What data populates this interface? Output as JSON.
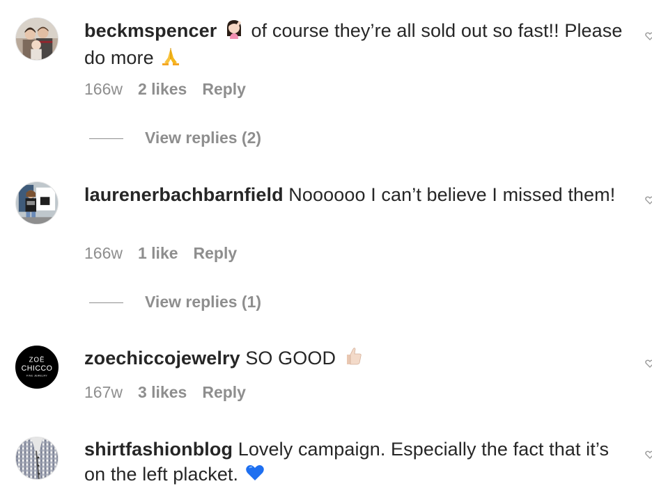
{
  "comments": [
    {
      "username": "beckmspencer",
      "text_before": "of course they’re all sold out so fast!! Please do more",
      "time": "166w",
      "likes": "2 likes",
      "reply": "Reply",
      "view_replies": "View replies (2)",
      "emoji_1": "woman-facepalming-icon",
      "emoji_2": "folded-hands-icon"
    },
    {
      "username": "laurenerbachbarnfield",
      "text": "Noooooo I can’t believe I missed them!",
      "time": "166w",
      "likes": "1 like",
      "reply": "Reply",
      "view_replies": "View replies (1)"
    },
    {
      "username": "zoechiccojewelry",
      "text": "SO GOOD",
      "time": "167w",
      "likes": "3 likes",
      "reply": "Reply",
      "avatar_line1": "ZOË",
      "avatar_line2": "CHICCO",
      "avatar_line3": "FINE JEWELRY",
      "emoji": "thumbs-up-icon"
    },
    {
      "username": "shirtfashionblog",
      "text": "Lovely campaign. Especially the fact that it’s on the left placket.",
      "emoji": "blue-heart-icon"
    }
  ],
  "colors": {
    "text": "#262626",
    "secondary": "#8e8e8e",
    "zoe_avatar_bg": "#000000",
    "blue_heart": "#1e6ff0"
  }
}
